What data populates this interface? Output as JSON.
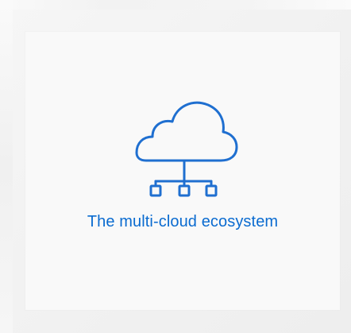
{
  "tile": {
    "label": "The multi-cloud ecosystem",
    "icon": "cloud-network-icon",
    "accent_color": "#1f6fd0"
  }
}
